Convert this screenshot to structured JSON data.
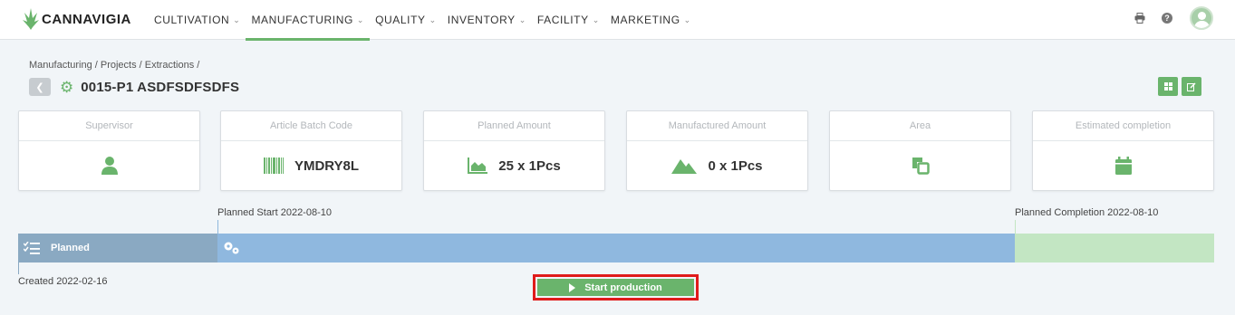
{
  "app": {
    "logo_text": "CANNAVIGIA"
  },
  "nav": {
    "items": [
      {
        "label": "CULTIVATION"
      },
      {
        "label": "MANUFACTURING"
      },
      {
        "label": "QUALITY"
      },
      {
        "label": "INVENTORY"
      },
      {
        "label": "FACILITY"
      },
      {
        "label": "MARKETING"
      }
    ],
    "active": "MANUFACTURING"
  },
  "header": {
    "breadcrumb": "Manufacturing / Projects / Extractions /",
    "title": "0015-P1 ASDFSDFSDFS"
  },
  "cards": [
    {
      "label": "Supervisor",
      "value": "",
      "icon": "user-icon"
    },
    {
      "label": "Article Batch Code",
      "value": "YMDRY8L",
      "icon": "barcode-icon"
    },
    {
      "label": "Planned Amount",
      "value": "25 x 1Pcs",
      "icon": "area-chart-icon"
    },
    {
      "label": "Manufactured Amount",
      "value": "0 x 1Pcs",
      "icon": "mountain-icon"
    },
    {
      "label": "Area",
      "value": "",
      "icon": "clone-icon"
    },
    {
      "label": "Estimated completion",
      "value": "",
      "icon": "calendar-icon"
    }
  ],
  "timeline": {
    "planned_start": "Planned Start 2022-08-10",
    "planned_completion": "Planned Completion 2022-08-10",
    "created": "Created 2022-02-16",
    "stage_label": "Planned"
  },
  "actions": {
    "start_production": "Start production"
  },
  "colors": {
    "accent": "#6ab46c",
    "highlight_border": "#e01b1b",
    "planned_segment": "#8aa9c2",
    "production_segment": "#8fb8df",
    "after_segment": "#c3e6c3"
  }
}
